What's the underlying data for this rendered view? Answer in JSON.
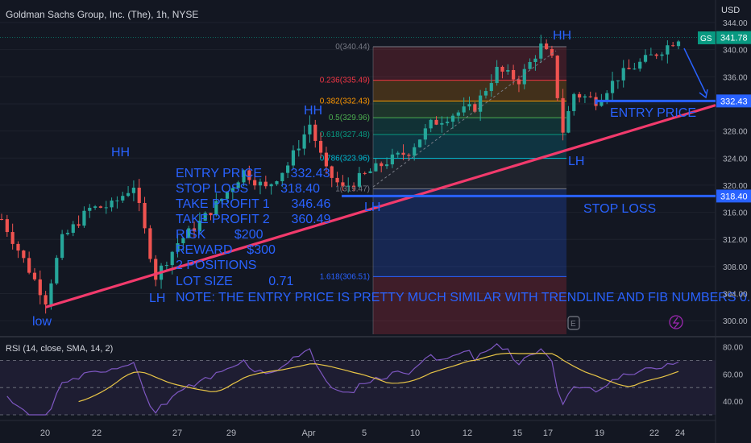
{
  "header": {
    "title": "Goldman Sachs Group, Inc. (The), 1h, NYSE",
    "currency": "USD"
  },
  "price_badges": {
    "symbol": "GS",
    "last": "341.78",
    "entry": "332.43",
    "stop": "318.40"
  },
  "colors": {
    "background": "#131722",
    "up": "#26a69a",
    "down": "#ef5350",
    "trendline": "#f23a6c",
    "annotation": "#2962ff",
    "rsi": "#7e57c2",
    "rsi_sma": "#e8c547"
  },
  "annotations": {
    "hh1": "HH",
    "hh2": "HH",
    "hh3": "HH",
    "lh1": "LH",
    "lh2": "LH",
    "lh3": "LH",
    "low": "low",
    "entry_price": "ENTRY PRICE",
    "stop_loss": "STOP LOSS"
  },
  "trade_plan": {
    "line1": "ENTRY PRICE        332.43",
    "line2": "STOP LOSS         318.40",
    "line3": "TAKE PROFIT 1      346.46",
    "line4": "TAKE PROFIT 2      360.49",
    "line5": "RISK        $200",
    "line6": "REWARD    $300",
    "line7": "2 POSITIONS",
    "line8": "LOT SIZE          0.71",
    "note": "NOTE: THE ENTRY PRICE IS PRETTY MUCH SIMILAR WITH TRENDLINE AND FIB NUMBERS 0.38."
  },
  "fib_levels": [
    {
      "ratio": "0",
      "label": "0(340.44)",
      "price": 340.44,
      "color": "#787b86"
    },
    {
      "ratio": "0.236",
      "label": "0.236(335.49)",
      "price": 335.49,
      "color": "#f23645"
    },
    {
      "ratio": "0.382",
      "label": "0.382(332.43)",
      "price": 332.43,
      "color": "#ff9800"
    },
    {
      "ratio": "0.5",
      "label": "0.5(329.96)",
      "price": 329.96,
      "color": "#4caf50"
    },
    {
      "ratio": "0.618",
      "label": "0.618(327.48)",
      "price": 327.48,
      "color": "#089981"
    },
    {
      "ratio": "0.786",
      "label": "0.786(323.96)",
      "price": 323.96,
      "color": "#00bcd4"
    },
    {
      "ratio": "1",
      "label": "1(319.47)",
      "price": 319.47,
      "color": "#787b86"
    },
    {
      "ratio": "1.618",
      "label": "1.618(306.51)",
      "price": 306.51,
      "color": "#2962ff"
    }
  ],
  "chart_data": {
    "type": "candlestick",
    "title": "Goldman Sachs Group, Inc. (The), 1h, NYSE",
    "ylim": [
      298,
      344
    ],
    "y_ticks": [
      300,
      304,
      308,
      312,
      316,
      320,
      324,
      328,
      332,
      336,
      340,
      344
    ],
    "x_ticks": [
      "20",
      "22",
      "27",
      "29",
      "Apr",
      "5",
      "10",
      "12",
      "15",
      "17",
      "19",
      "22",
      "24"
    ],
    "approx_path": [
      {
        "x": 0,
        "price": 315.0
      },
      {
        "x": 6,
        "price": 306.0
      },
      {
        "x": 8,
        "price": 303.0
      },
      {
        "x": 11,
        "price": 312.0
      },
      {
        "x": 16,
        "price": 316.5
      },
      {
        "x": 20,
        "price": 317.0
      },
      {
        "x": 24,
        "price": 320.0
      },
      {
        "x": 28,
        "price": 306.5
      },
      {
        "x": 32,
        "price": 311.5
      },
      {
        "x": 36,
        "price": 314.5
      },
      {
        "x": 40,
        "price": 318.0
      },
      {
        "x": 44,
        "price": 322.0
      },
      {
        "x": 48,
        "price": 319.5
      },
      {
        "x": 52,
        "price": 323.0
      },
      {
        "x": 56,
        "price": 329.0
      },
      {
        "x": 59,
        "price": 322.0
      },
      {
        "x": 62,
        "price": 319.5
      },
      {
        "x": 66,
        "price": 321.5
      },
      {
        "x": 70,
        "price": 323.5
      },
      {
        "x": 74,
        "price": 325.0
      },
      {
        "x": 78,
        "price": 329.0
      },
      {
        "x": 82,
        "price": 330.5
      },
      {
        "x": 86,
        "price": 331.5
      },
      {
        "x": 90,
        "price": 337.0
      },
      {
        "x": 94,
        "price": 335.5
      },
      {
        "x": 98,
        "price": 340.5
      },
      {
        "x": 100,
        "price": 338.5
      },
      {
        "x": 102,
        "price": 328.0
      },
      {
        "x": 104,
        "price": 333.5
      },
      {
        "x": 108,
        "price": 332.5
      },
      {
        "x": 112,
        "price": 336.0
      },
      {
        "x": 116,
        "price": 338.0
      },
      {
        "x": 120,
        "price": 340.0
      },
      {
        "x": 123,
        "price": 341.78
      }
    ],
    "trendline": {
      "from": {
        "x": 8,
        "price": 302.0
      },
      "to": {
        "x": 132,
        "price": 331.8
      }
    },
    "entry_level": 332.43,
    "stop_level": 318.4,
    "rsi": {
      "label": "RSI (14, close, SMA, 14, 2)",
      "ylim": [
        30,
        85
      ],
      "ticks": [
        40,
        60,
        80
      ],
      "bands": [
        70,
        50,
        30
      ]
    }
  }
}
